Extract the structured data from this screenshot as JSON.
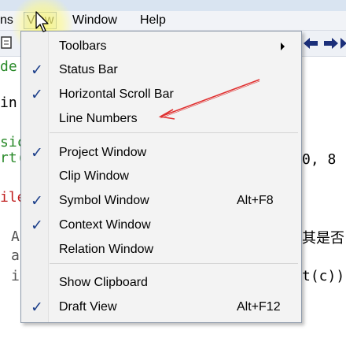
{
  "menubar": {
    "items": [
      {
        "label": "ns"
      },
      {
        "label": "View"
      },
      {
        "label": "Window"
      },
      {
        "label": "Help"
      }
    ]
  },
  "editor": {
    "fragments": [
      "de",
      "in",
      "sic",
      "rt(",
      "ile",
      "A",
      "a",
      "i",
      "0,  8",
      "其是否",
      "t(c))"
    ]
  },
  "view_menu": {
    "items": [
      {
        "label": "Toolbars",
        "checked": false,
        "accel": "",
        "submenu": true
      },
      {
        "label": "Status Bar",
        "checked": true,
        "accel": ""
      },
      {
        "label": "Horizontal Scroll Bar",
        "checked": true,
        "accel": ""
      },
      {
        "label": "Line Numbers",
        "checked": false,
        "accel": ""
      },
      {
        "label": "Project Window",
        "checked": true,
        "accel": ""
      },
      {
        "label": "Clip Window",
        "checked": false,
        "accel": ""
      },
      {
        "label": "Symbol Window",
        "checked": true,
        "accel": "Alt+F8"
      },
      {
        "label": "Context Window",
        "checked": true,
        "accel": ""
      },
      {
        "label": "Relation Window",
        "checked": false,
        "accel": ""
      },
      {
        "label": "Show Clipboard",
        "checked": false,
        "accel": ""
      },
      {
        "label": "Draft View",
        "checked": true,
        "accel": "Alt+F12"
      }
    ],
    "check_glyph": "✓"
  },
  "colors": {
    "annotation_arrow": "#e03030",
    "check": "#1c3f8a"
  }
}
